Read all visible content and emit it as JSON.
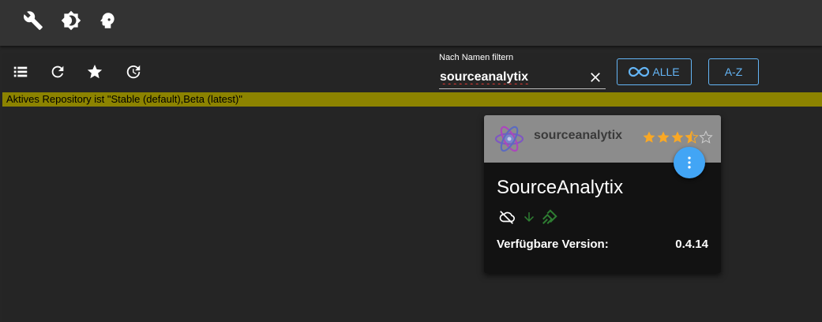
{
  "topbar": {
    "icons": [
      "wrench-icon",
      "brightness-icon",
      "head-icon"
    ]
  },
  "toolbar": {
    "icons": [
      "list-icon",
      "refresh-icon",
      "star-icon",
      "history-icon"
    ],
    "filter_label": "Nach Namen filtern",
    "filter_value": "sourceanalytix",
    "all_button": "ALLE",
    "az_button": "A-Z"
  },
  "banner": {
    "text": "Aktives Repository ist \"Stable (default),Beta (latest)\""
  },
  "card": {
    "repo_name": "sourceanalytix",
    "rating": 3.5,
    "rating_max": 5,
    "title": "SourceAnalytix",
    "status_icons": [
      "cloud-off-icon",
      "download-arrow-icon",
      "signal-icon"
    ],
    "version_label": "Verfügbare Version:",
    "version_value": "0.4.14"
  },
  "colors": {
    "accent": "#64b5f6",
    "banner": "#8c8300",
    "star": "#f9a825",
    "status_green": "#2e7d32"
  }
}
